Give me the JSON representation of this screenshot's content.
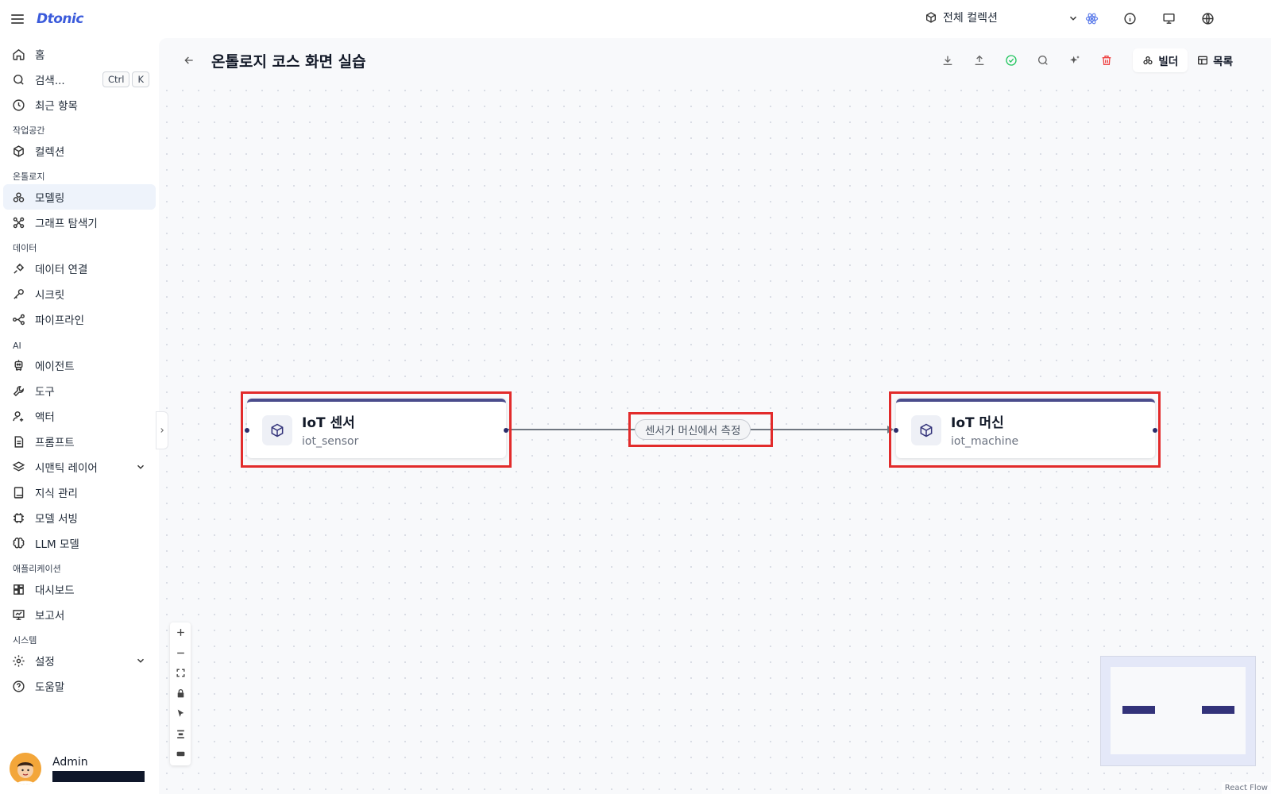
{
  "app": {
    "logo": "Dtonic"
  },
  "sidebar": {
    "home": "홈",
    "search": {
      "label": "검색...",
      "kbd1": "Ctrl",
      "kbd2": "K"
    },
    "recent": "최근 항목",
    "sections": {
      "workspace": "작업공간",
      "ontology": "온톨로지",
      "data": "데이터",
      "ai": "AI",
      "apps": "애플리케이션",
      "system": "시스템"
    },
    "items": {
      "collection": "컬렉션",
      "modeling": "모델링",
      "graph_explorer": "그래프 탐색기",
      "data_connection": "데이터 연결",
      "secret": "시크릿",
      "pipeline": "파이프라인",
      "agent": "에이전트",
      "tool": "도구",
      "actor": "액터",
      "prompt": "프롬프트",
      "semantic_layer": "시맨틱 레이어",
      "knowledge": "지식 관리",
      "model_serving": "모델 서빙",
      "llm_model": "LLM 모델",
      "dashboard": "대시보드",
      "report": "보고서",
      "settings": "설정",
      "help": "도움말"
    },
    "user": {
      "name": "Admin"
    }
  },
  "topbar": {
    "collection_select": "전체 컬렉션"
  },
  "page": {
    "title": "온톨로지 코스 화면 실습",
    "view_builder": "빌더",
    "view_list": "목록"
  },
  "graph": {
    "nodes": [
      {
        "title": "IoT 센서",
        "subtitle": "iot_sensor"
      },
      {
        "title": "IoT 머신",
        "subtitle": "iot_machine"
      }
    ],
    "edge_label": "센서가 머신에서 측정"
  },
  "attribution": "React Flow",
  "colors": {
    "accent": "#3b5bdb",
    "node_border": "#4a4c8c",
    "highlight": "#e22b2b",
    "active_nav": "#eef3fb",
    "success_icon": "#22c55e",
    "danger_icon": "#ef4444"
  }
}
